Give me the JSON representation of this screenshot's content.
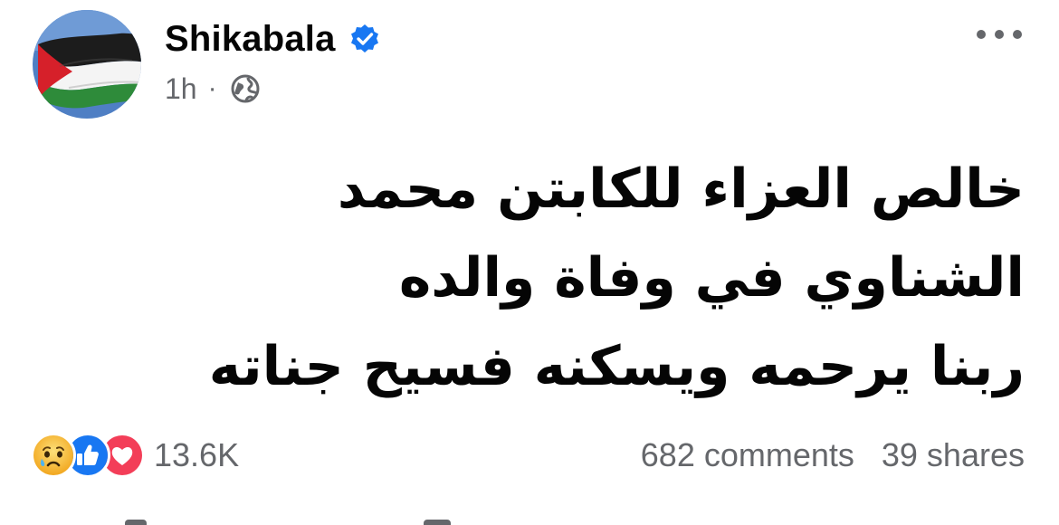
{
  "post": {
    "author": "Shikabala",
    "time": "1h",
    "separator": "·",
    "lines": [
      "خالص العزاء للكابتن محمد",
      "الشناوي في وفاة والده",
      "ربنا يرحمه ويسكنه فسيح جناته"
    ]
  },
  "reactions": {
    "types": [
      "sad-icon",
      "like-icon",
      "love-icon"
    ],
    "count": "13.6K"
  },
  "stats": {
    "comments": "682 comments",
    "shares": "39 shares"
  },
  "colors": {
    "text": "#050505",
    "secondary": "#65676b",
    "verified": "#1877f2",
    "like": "#1877f2",
    "love": "#f33e58",
    "sad": "#f7b125"
  }
}
